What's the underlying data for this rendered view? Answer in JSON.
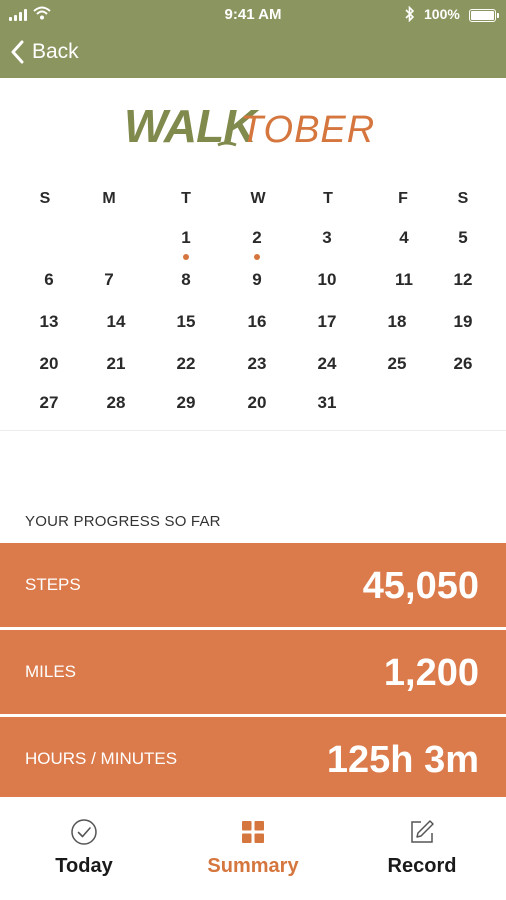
{
  "status_bar": {
    "time": "9:41 AM",
    "battery": "100%",
    "signal_icon": "cellular-signal-icon",
    "wifi_icon": "wifi-icon",
    "bluetooth_icon": "bluetooth-icon",
    "battery_icon": "battery-icon"
  },
  "nav": {
    "back_label": "Back",
    "back_icon": "chevron-left-icon"
  },
  "logo": {
    "part1": "WALK",
    "part2": "TOBER",
    "colors": {
      "part1": "#7f8a4c",
      "part2": "#d5763e"
    }
  },
  "calendar": {
    "day_headers": [
      "S",
      "M",
      "T",
      "W",
      "T",
      "F",
      "S"
    ],
    "weeks": [
      [
        "",
        "",
        "1",
        "2",
        "3",
        "4",
        "5"
      ],
      [
        "6",
        "7",
        "8",
        "9",
        "10",
        "11",
        "12"
      ],
      [
        "13",
        "14",
        "15",
        "16",
        "17",
        "18",
        "19"
      ],
      [
        "20",
        "21",
        "22",
        "23",
        "24",
        "25",
        "26"
      ],
      [
        "27",
        "28",
        "29",
        "20",
        "31",
        "",
        ""
      ]
    ],
    "marked_days": [
      "1",
      "2"
    ],
    "marker_color": "#d5763e"
  },
  "progress": {
    "heading": "YOUR PROGRESS SO FAR",
    "stats": [
      {
        "label": "STEPS",
        "value": "45,050"
      },
      {
        "label": "MILES",
        "value": "1,200"
      },
      {
        "label": "HOURS / MINUTES",
        "value": "125h 3m"
      }
    ]
  },
  "tabs": [
    {
      "label": "Today",
      "icon": "check-circle-icon",
      "active": false
    },
    {
      "label": "Summary",
      "icon": "grid-icon",
      "active": true
    },
    {
      "label": "Record",
      "icon": "pencil-square-icon",
      "active": false
    }
  ],
  "colors": {
    "header": "#8b955f",
    "accent": "#d5763e",
    "stat_background": "#db7a4a"
  }
}
